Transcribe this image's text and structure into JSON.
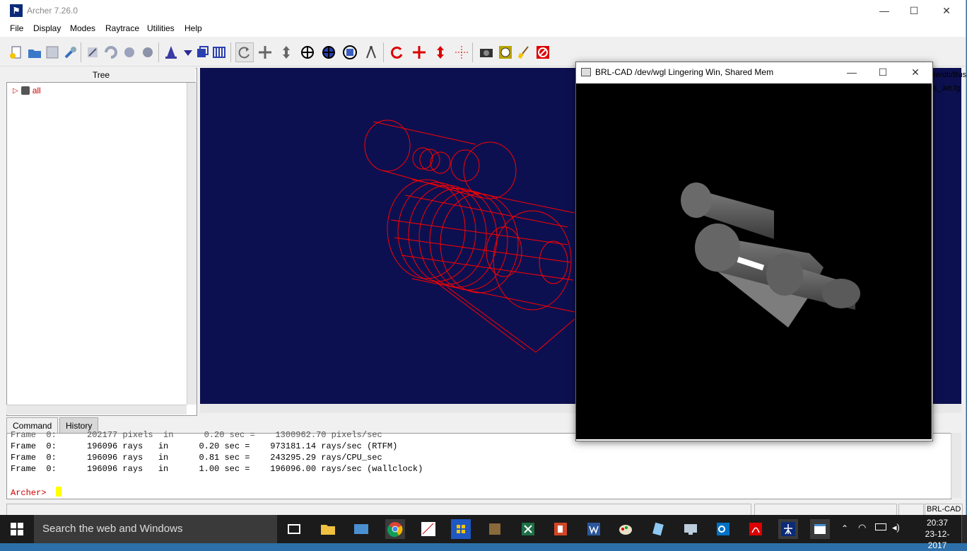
{
  "window": {
    "title": "Archer 7.26.0",
    "minimize": "—",
    "maximize": "☐",
    "close": "✕"
  },
  "menu": [
    "File",
    "Display",
    "Modes",
    "Raytrace",
    "Utilities",
    "Help"
  ],
  "tree": {
    "header": "Tree",
    "items": [
      {
        "label": "all"
      }
    ]
  },
  "background_path": {
    "line1": "re/db/Bus",
    "line2": "s_Jet.fg"
  },
  "tabs": {
    "command": "Command",
    "history": "History"
  },
  "console": {
    "lines": [
      "Frame  0:      202177 pixels  in      0.20 sec =    1300962.70 pixels/sec",
      "Frame  0:      196096 rays   in      0.20 sec =    973181.14 rays/sec (RTFM)",
      "Frame  0:      196096 rays   in      0.81 sec =    243295.29 rays/CPU_sec",
      "Frame  0:      196096 rays   in      1.00 sec =    196096.00 rays/sec (wallclock)"
    ],
    "prompt": "Archer>"
  },
  "statusbar": {
    "right": "BRL-CAD"
  },
  "raytrace_window": {
    "title": "BRL-CAD /dev/wgl Lingering Win, Shared Mem",
    "minimize": "—",
    "maximize": "☐",
    "close": "✕"
  },
  "taskbar": {
    "search_placeholder": "Search the web and Windows",
    "apps": [
      "task-view",
      "file-explorer",
      "store",
      "chrome",
      "paint",
      "c64",
      "minecraft",
      "excel",
      "powerpoint",
      "word",
      "paint-app",
      "notepad",
      "remote",
      "outlook",
      "acrobat",
      "archer",
      "active-window"
    ],
    "time": "20:37",
    "date": "23-12-2017"
  },
  "colors": {
    "viewport_bg": "#0d1050",
    "wireframe": "#ff0000",
    "prompt": "#cc0000",
    "cursor": "#ffff00"
  }
}
